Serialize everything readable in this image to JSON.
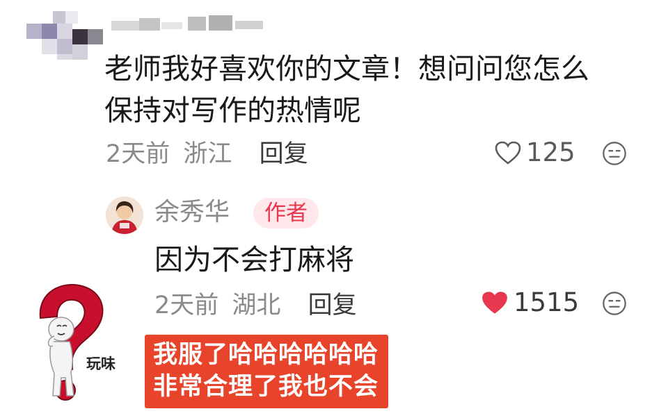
{
  "comment": {
    "text_line1": "老师我好喜欢你的文章！想问问您怎么",
    "text_line2": "保持对写作的热情呢",
    "time": "2天前",
    "location": "浙江",
    "reply_label": "回复",
    "likes": "125"
  },
  "reply": {
    "author": "余秀华",
    "tag": "作者",
    "text": "因为不会打麻将",
    "time": "2天前",
    "location": "湖北",
    "reply_label": "回复",
    "likes": "1515"
  },
  "meme": {
    "label": "玩味",
    "caption_line1": "我服了哈哈哈哈哈哈",
    "caption_line2": "非常合理了我也不会"
  },
  "colors": {
    "heart_red": "#e8384f",
    "tag_bg": "#ffe7ea",
    "caption_bg": "#e8442b",
    "question_red": "#c8102e"
  }
}
